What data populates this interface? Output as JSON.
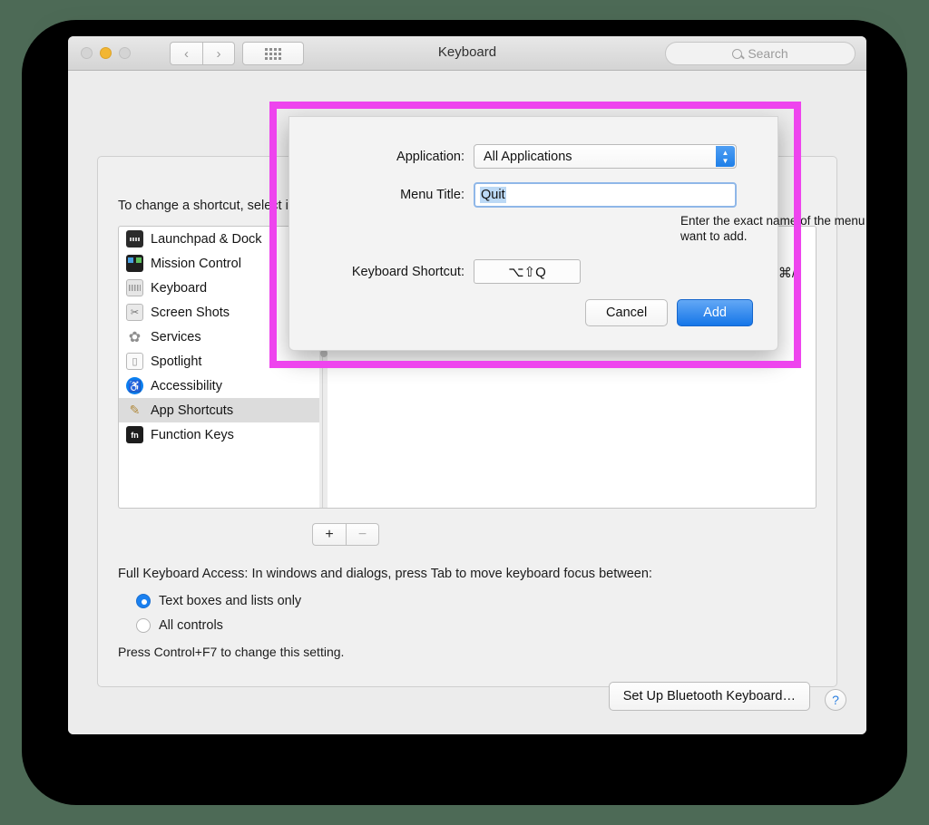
{
  "window": {
    "title": "Keyboard",
    "traffic_lights": [
      "close",
      "minimize",
      "zoom"
    ],
    "nav": {
      "back": "‹",
      "forward": "›",
      "show_all": "show-all-grid"
    },
    "search": {
      "placeholder": "Search",
      "icon": "search-icon"
    }
  },
  "pane": {
    "intro": "To change a shortcut, select it, click the key combination, and then type the new keys.",
    "sidebar": [
      {
        "label": "Launchpad & Dock",
        "icon": "launchpad-icon"
      },
      {
        "label": "Mission Control",
        "icon": "mission-control-icon"
      },
      {
        "label": "Keyboard",
        "icon": "keyboard-icon"
      },
      {
        "label": "Screen Shots",
        "icon": "screenshot-icon"
      },
      {
        "label": "Services",
        "icon": "services-gear-icon"
      },
      {
        "label": "Spotlight",
        "icon": "spotlight-icon"
      },
      {
        "label": "Accessibility",
        "icon": "accessibility-icon"
      },
      {
        "label": "App Shortcuts",
        "icon": "app-shortcuts-icon"
      },
      {
        "label": "Function Keys",
        "icon": "function-keys-icon"
      }
    ],
    "selected_sidebar_item": "App Shortcuts",
    "right_column_shortcut": "⇧⌘/",
    "add_button": "+",
    "remove_button": "−",
    "full_keyboard_access_title": "Full Keyboard Access: In windows and dialogs, press Tab to move keyboard focus between:",
    "radios": [
      {
        "label": "Text boxes and lists only",
        "selected": true
      },
      {
        "label": "All controls",
        "selected": false
      }
    ],
    "control_hint": "Press Control+F7 to change this setting.",
    "bluetooth_button": "Set Up Bluetooth Keyboard…",
    "help_button": "?"
  },
  "sheet": {
    "application_label": "Application:",
    "application_value": "All Applications",
    "menu_title_label": "Menu Title:",
    "menu_title_value": "Quit",
    "helper_text": "Enter the exact name of the menu command you want to add.",
    "shortcut_label": "Keyboard Shortcut:",
    "shortcut_value": "⌥⇧Q",
    "cancel_label": "Cancel",
    "add_label": "Add"
  },
  "annotation": {
    "color": "#ee44ee"
  }
}
